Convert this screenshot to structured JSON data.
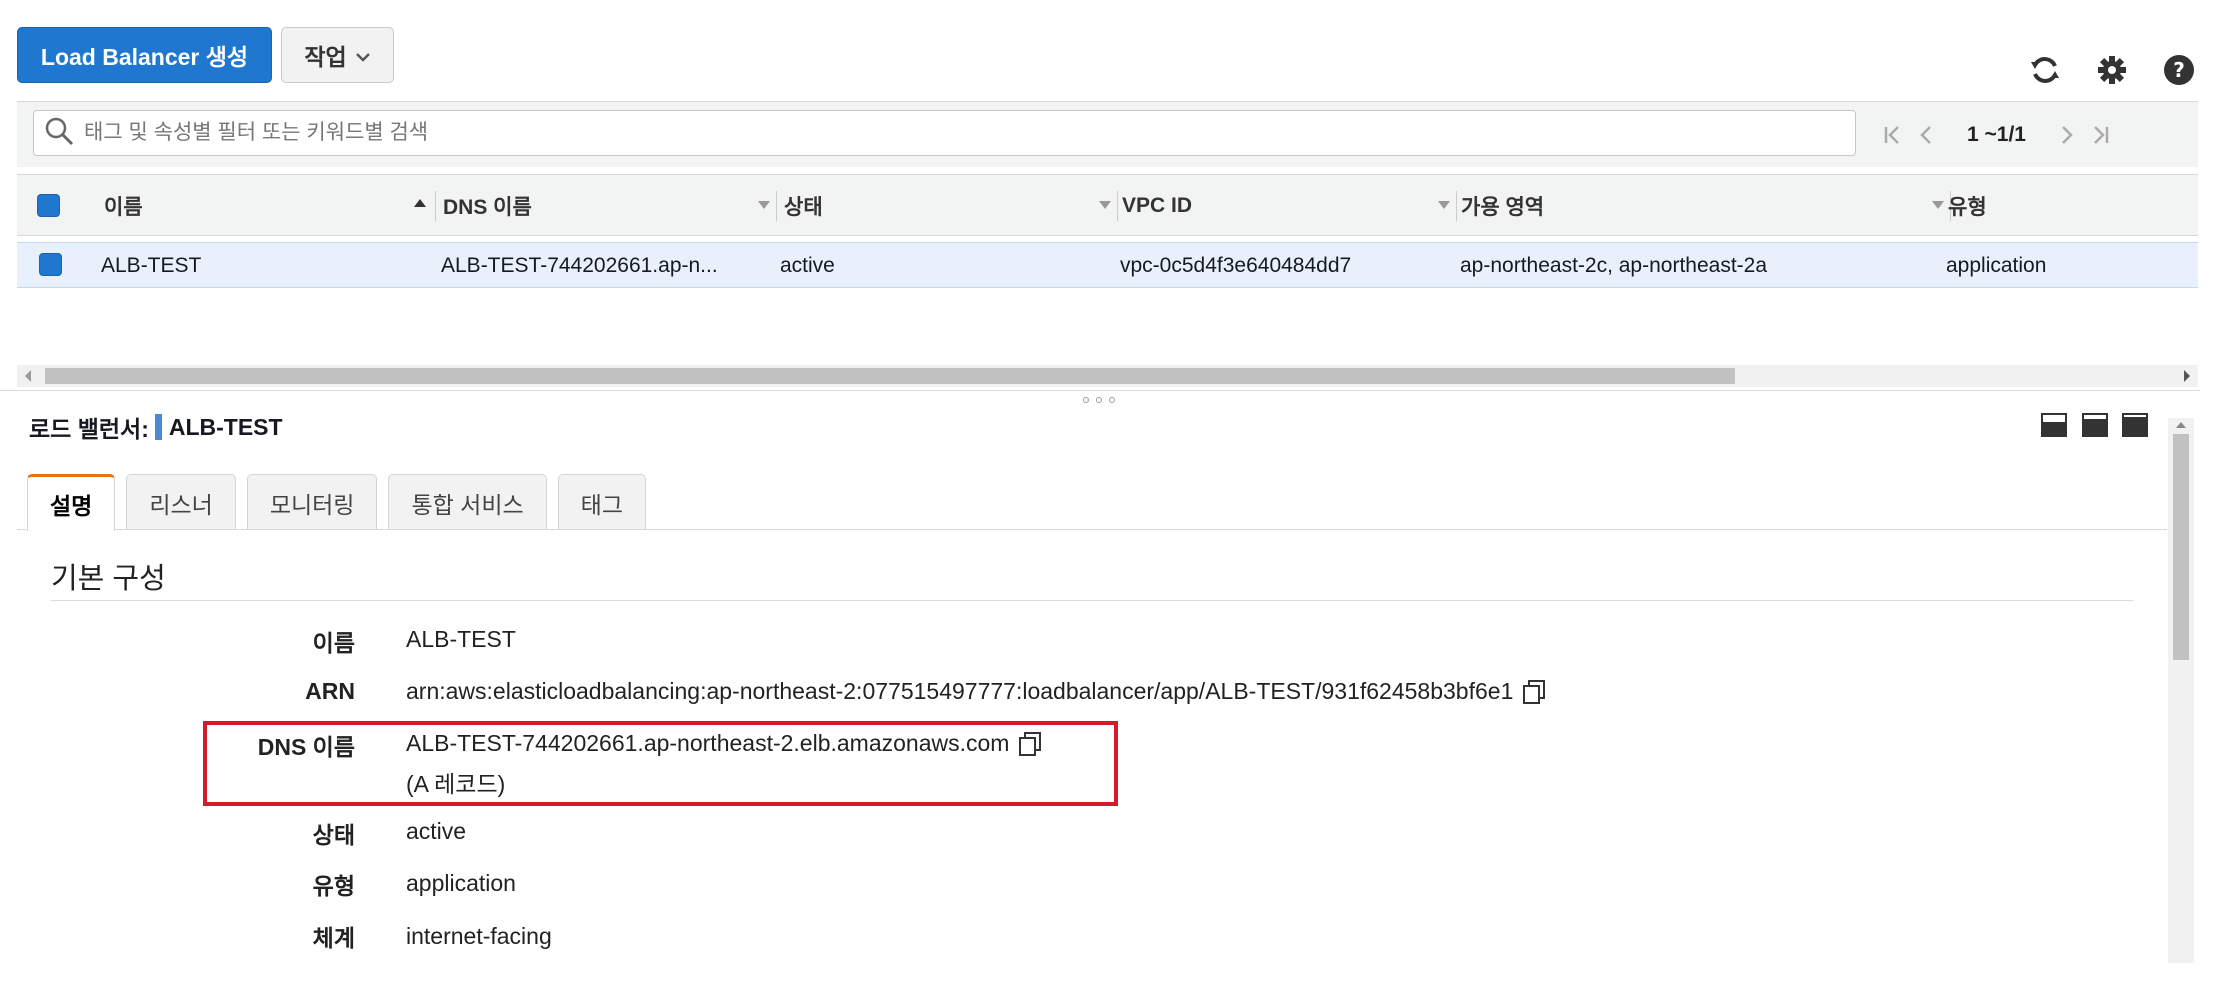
{
  "toolbar": {
    "create_label": "Load Balancer 생성",
    "actions_label": "작업"
  },
  "top_icons": [
    "refresh-icon",
    "gear-icon",
    "help-icon"
  ],
  "search": {
    "placeholder": "태그 및 속성별 필터 또는 키워드별 검색"
  },
  "pager": {
    "text": "1 ~1/1"
  },
  "table": {
    "columns": [
      "이름",
      "DNS 이름",
      "상태",
      "VPC ID",
      "가용 영역",
      "유형"
    ],
    "rows": [
      {
        "name": "ALB-TEST",
        "dns": "ALB-TEST-744202661.ap-n...",
        "state": "active",
        "vpc": "vpc-0c5d4f3e640484dd7",
        "az": "ap-northeast-2c, ap-northeast-2a",
        "type": "application"
      }
    ]
  },
  "detail": {
    "title_prefix": "로드 밸런서:",
    "title_name": "ALB-TEST",
    "tabs": [
      "설명",
      "리스너",
      "모니터링",
      "통합 서비스",
      "태그"
    ],
    "section_title": "기본 구성",
    "fields": {
      "name_label": "이름",
      "name_value": "ALB-TEST",
      "arn_label": "ARN",
      "arn_value": "arn:aws:elasticloadbalancing:ap-northeast-2:077515497777:loadbalancer/app/ALB-TEST/931f62458b3bf6e1",
      "dns_label": "DNS 이름",
      "dns_value": "ALB-TEST-744202661.ap-northeast-2.elb.amazonaws.com",
      "dns_record": "(A 레코드)",
      "state_label": "상태",
      "state_value": "active",
      "type_label": "유형",
      "type_value": "application",
      "scheme_label": "체계",
      "scheme_value": "internet-facing"
    }
  },
  "colors": {
    "primary": "#1f77d0",
    "selected_row": "#e8f1fb",
    "tab_accent": "#ec7211",
    "highlight": "#d21c2c"
  }
}
